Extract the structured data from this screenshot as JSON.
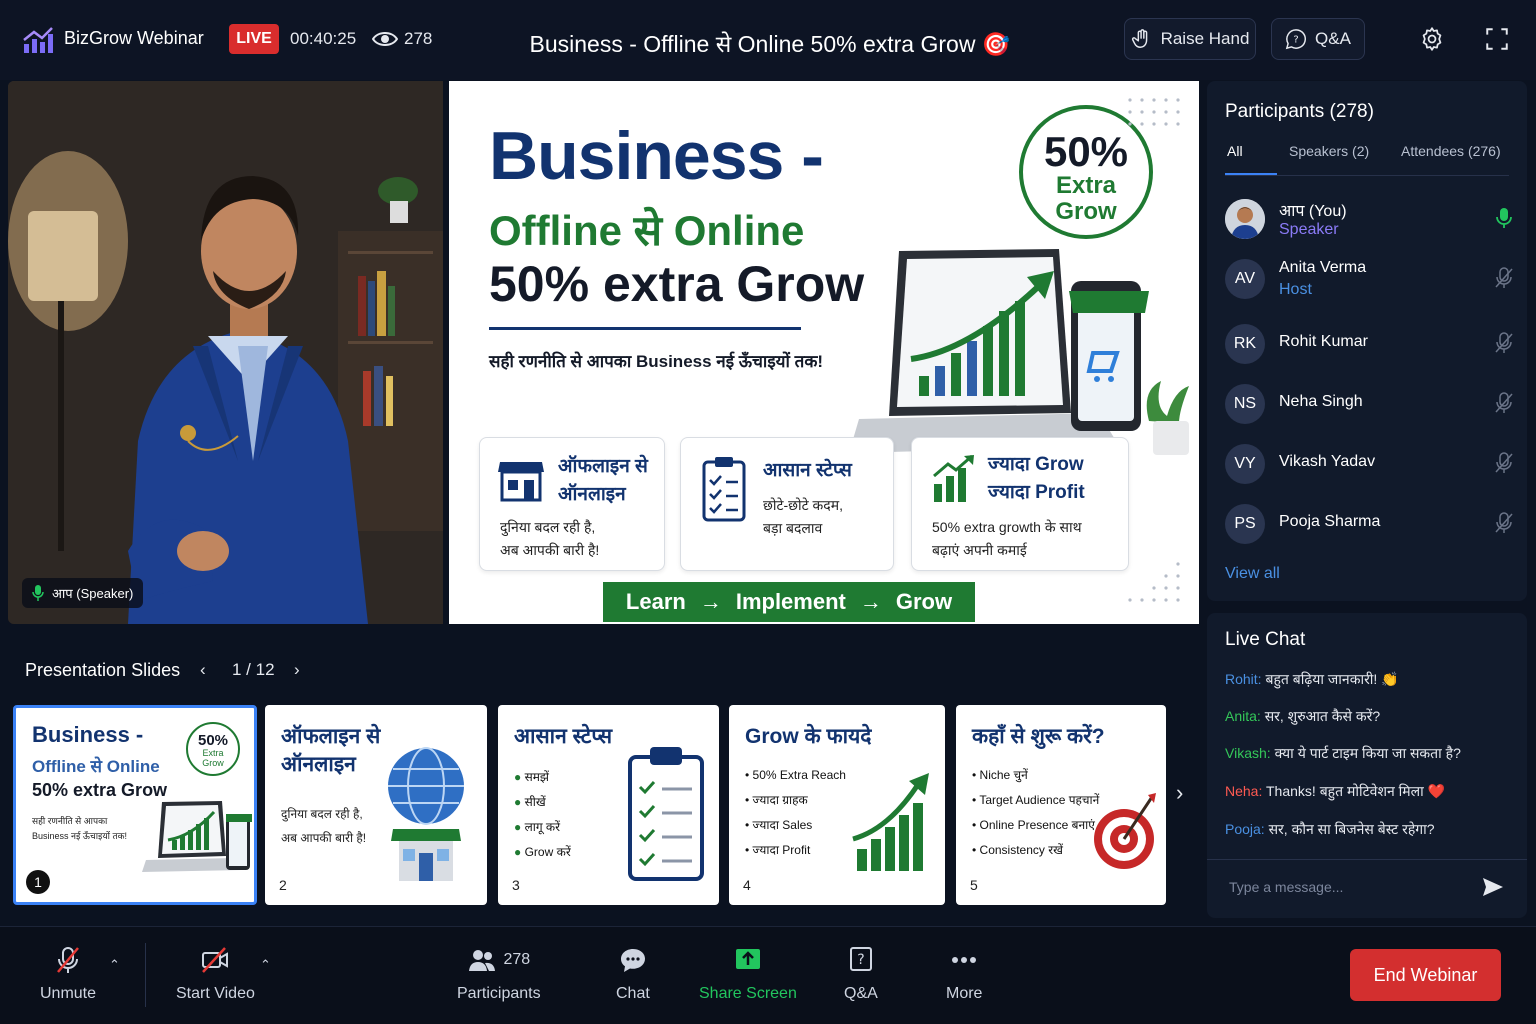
{
  "header": {
    "brand": "BizGrow Webinar",
    "live": "LIVE",
    "timer": "00:40:25",
    "viewers": "278",
    "title": "Business - Offline से Online 50% extra Grow 🎯",
    "raise_hand": "Raise Hand",
    "qa": "Q&A"
  },
  "video": {
    "speaker_label": "आप (Speaker)"
  },
  "slide": {
    "line1": "Business -",
    "line2": "Offline से Online",
    "line3": "50% extra Grow",
    "subtitle": "सही रणनीति से आपका Business नई ऊँचाइयों तक!",
    "badge_percent": "50%",
    "badge_line1": "Extra",
    "badge_line2": "Grow",
    "cards": [
      {
        "title1": "ऑफलाइन से",
        "title2": "ऑनलाइन",
        "body1": "दुनिया बदल रही है,",
        "body2": "अब आपकी बारी है!"
      },
      {
        "title1": "आसान स्टेप्स",
        "title2": "",
        "body1": "छोटे-छोटे कदम,",
        "body2": "बड़ा बदलाव"
      },
      {
        "title1": "ज्यादा Grow",
        "title2": "ज्यादा Profit",
        "body1": "50% extra growth के साथ",
        "body2": "बढ़ाएं अपनी कमाई"
      }
    ],
    "banner": {
      "step1": "Learn",
      "arrow": "→",
      "step2": "Implement",
      "step3": "Grow"
    }
  },
  "participants": {
    "title": "Participants (278)",
    "tabs": [
      "All",
      "Speakers (2)",
      "Attendees (276)"
    ],
    "list": [
      {
        "initials": "",
        "name": "आप (You)",
        "role": "Speaker"
      },
      {
        "initials": "AV",
        "name": "Anita Verma",
        "role": "Host"
      },
      {
        "initials": "RK",
        "name": "Rohit Kumar",
        "role": ""
      },
      {
        "initials": "NS",
        "name": "Neha Singh",
        "role": ""
      },
      {
        "initials": "VY",
        "name": "Vikash Yadav",
        "role": ""
      },
      {
        "initials": "PS",
        "name": "Pooja Sharma",
        "role": ""
      }
    ],
    "view_all": "View all"
  },
  "chat": {
    "title": "Live Chat",
    "messages": [
      {
        "user": "Rohit:",
        "text": "बहुत बढ़िया जानकारी! 👏",
        "color": "#4a90e2"
      },
      {
        "user": "Anita:",
        "text": "सर, शुरुआत कैसे करें?",
        "color": "#34c759"
      },
      {
        "user": "Vikash:",
        "text": "क्या ये पार्ट टाइम किया जा सकता है?",
        "color": "#34c759"
      },
      {
        "user": "Neha:",
        "text": "Thanks! बहुत मोटिवेशन मिला ❤️",
        "color": "#ff5a52"
      },
      {
        "user": "Pooja:",
        "text": "सर, कौन सा बिजनेस बेस्ट रहेगा?",
        "color": "#4a90e2"
      }
    ],
    "placeholder": "Type a message..."
  },
  "strip": {
    "title": "Presentation Slides",
    "page": "1 / 12",
    "thumbs": [
      {
        "num": "1",
        "title1": "Business -",
        "title2": "Offline से Online",
        "title3": "50% extra Grow",
        "badge": "50%",
        "badge_sub1": "Extra",
        "badge_sub2": "Grow",
        "sub1": "सही रणनीति से आपका",
        "sub2": "Business नई ऊँचाइयों तक!"
      },
      {
        "num": "2",
        "title1": "ऑफलाइन से",
        "title2": "ऑनलाइन",
        "body1": "दुनिया बदल रही है,",
        "body2": "अब आपकी बारी है!"
      },
      {
        "num": "3",
        "title": "आसान स्टेप्स",
        "items": [
          "समझें",
          "सीखें",
          "लागू करें",
          "Grow करें"
        ]
      },
      {
        "num": "4",
        "title": "Grow के फायदे",
        "items": [
          "50% Extra Reach",
          "ज्यादा ग्राहक",
          "ज्यादा Sales",
          "ज्यादा Profit"
        ]
      },
      {
        "num": "5",
        "title": "कहाँ से शुरू करें?",
        "items": [
          "Niche चुनें",
          "Target Audience पहचानें",
          "Online Presence बनाएं",
          "Consistency रखें"
        ]
      }
    ]
  },
  "toolbar": {
    "unmute": "Unmute",
    "start_video": "Start Video",
    "participants_count": "278",
    "participants": "Participants",
    "chat": "Chat",
    "share_screen": "Share Screen",
    "qa": "Q&A",
    "more": "More",
    "end": "End Webinar"
  },
  "colors": {
    "accent_blue": "#3b82f6",
    "live_red": "#d92d2d",
    "green": "#1f7a32",
    "navy": "#12336f",
    "end_red": "#d32f2f",
    "share_green": "#22c55e"
  }
}
